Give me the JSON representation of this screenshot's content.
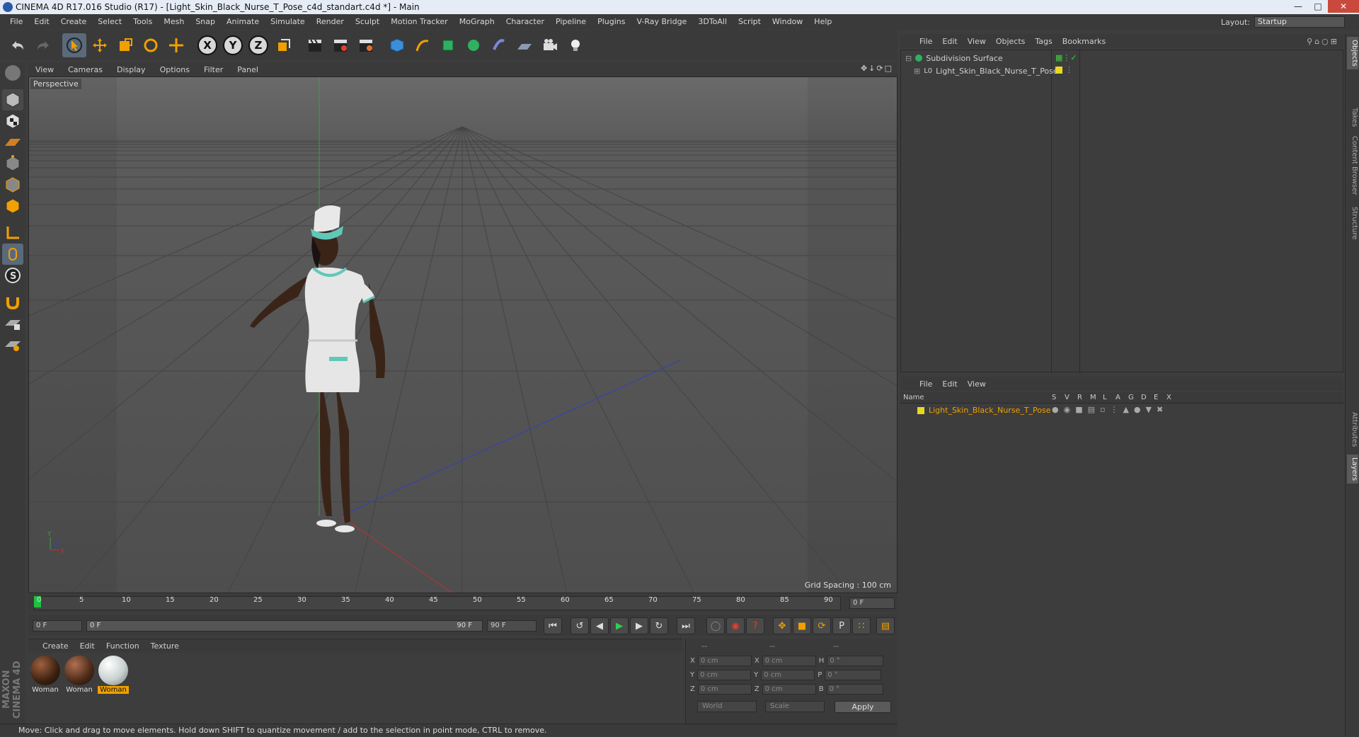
{
  "window": {
    "title": "CINEMA 4D R17.016 Studio (R17) - [Light_Skin_Black_Nurse_T_Pose_c4d_standart.c4d *] - Main"
  },
  "menubar": {
    "items": [
      "File",
      "Edit",
      "Create",
      "Select",
      "Tools",
      "Mesh",
      "Snap",
      "Animate",
      "Simulate",
      "Render",
      "Sculpt",
      "Motion Tracker",
      "MoGraph",
      "Character",
      "Pipeline",
      "Plugins",
      "V-Ray Bridge",
      "3DToAll",
      "Script",
      "Window",
      "Help"
    ]
  },
  "layout": {
    "label": "Layout:",
    "value": "Startup"
  },
  "viewport": {
    "menu": [
      "View",
      "Cameras",
      "Display",
      "Options",
      "Filter",
      "Panel"
    ],
    "label": "Perspective",
    "grid_spacing": "Grid Spacing : 100 cm",
    "axis_labels": {
      "y": "Y",
      "x": "X",
      "z": "Z"
    }
  },
  "timeline": {
    "ticks": [
      "0",
      "5",
      "10",
      "15",
      "20",
      "25",
      "30",
      "35",
      "40",
      "45",
      "50",
      "55",
      "60",
      "65",
      "70",
      "75",
      "80",
      "85",
      "90"
    ],
    "current_frame": "0 F"
  },
  "playback": {
    "start_frame": "0 F",
    "range_start": "0 F",
    "range_end": "90 F",
    "end_frame": "90 F"
  },
  "materials": {
    "menu": [
      "Create",
      "Edit",
      "Function",
      "Texture"
    ],
    "items": [
      {
        "name": "Woman",
        "selected": false
      },
      {
        "name": "Woman",
        "selected": false
      },
      {
        "name": "Woman",
        "selected": true
      }
    ]
  },
  "coordinates": {
    "headers": [
      "--",
      "--",
      "--"
    ],
    "rows": [
      {
        "a": "X",
        "av": "0 cm",
        "b": "X",
        "bv": "0 cm",
        "c": "H",
        "cv": "0 °"
      },
      {
        "a": "Y",
        "av": "0 cm",
        "b": "Y",
        "bv": "0 cm",
        "c": "P",
        "cv": "0 °"
      },
      {
        "a": "Z",
        "av": "0 cm",
        "b": "Z",
        "bv": "0 cm",
        "c": "B",
        "cv": "0 °"
      }
    ],
    "mode": "World",
    "type": "Scale",
    "apply": "Apply"
  },
  "status": "Move: Click and drag to move elements. Hold down SHIFT to quantize movement / add to the selection in point mode, CTRL to remove.",
  "object_manager": {
    "menu": [
      "File",
      "Edit",
      "View",
      "Objects",
      "Tags",
      "Bookmarks"
    ],
    "objects": [
      {
        "name": "Subdivision Surface"
      },
      {
        "name": "Light_Skin_Black_Nurse_T_Pose"
      }
    ]
  },
  "layer_manager": {
    "menu": [
      "File",
      "Edit",
      "View"
    ],
    "columns": [
      "Name",
      "S",
      "V",
      "R",
      "M",
      "L",
      "A",
      "G",
      "D",
      "E",
      "X"
    ],
    "layers": [
      {
        "name": "Light_Skin_Black_Nurse_T_Pose"
      }
    ]
  },
  "side_tabs": [
    "Objects",
    "Takes",
    "Content Browser",
    "Structure",
    "Attributes",
    "Layers"
  ],
  "branding": "MAXON CINEMA 4D",
  "colors": {
    "accent": "#f0a000",
    "layer_color": "#e8d820",
    "bg": "#3d3d3d",
    "viewport": "#555555"
  }
}
